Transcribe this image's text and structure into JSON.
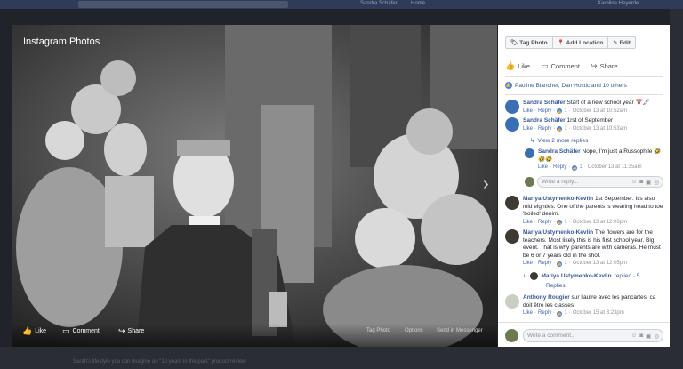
{
  "photo": {
    "title": "Instagram Photos",
    "actions": {
      "like": "Like",
      "comment": "Comment",
      "share": "Share"
    },
    "options": {
      "tag": "Tag Photo",
      "options": "Options",
      "messenger": "Send in Messenger"
    }
  },
  "panel": {
    "toolbar": {
      "tag_photo": "Tag Photo",
      "add_location": "Add Location",
      "edit": "Edit"
    },
    "actions": {
      "like": "Like",
      "comment": "Comment",
      "share": "Share"
    },
    "likes_text": "Pauline Blanchet, Dan Hostic and 10 others",
    "comments": [
      {
        "name": "Sandra Schäfer",
        "text": "Start of a new school year 📅🖊",
        "like": "Like",
        "reply": "Reply",
        "count": "1",
        "time": "October 13 at 10:52am"
      },
      {
        "name": "Sandra Schäfer",
        "text": "1rst of September",
        "like": "Like",
        "reply": "Reply",
        "count": "1",
        "time": "October 13 at 10:53am"
      },
      {
        "name": "Mariya Ustymenko-Kevlin",
        "text": "1st September. It's also mid eighties. One of the parents is wearing head to toe 'boiled' denim.",
        "like": "Like",
        "reply": "Reply",
        "count": "1",
        "time": "October 13 at 12:03pm"
      },
      {
        "name": "Mariya Ustymenko-Kevlin",
        "text": "The flowers are for the teachers. Most likely this is his first school year. Big event. That is why parents are with cameras. He must be 6 or 7 years old in the shot.",
        "like": "Like",
        "reply": "Reply",
        "count": "1",
        "time": "October 13 at 12:05pm"
      },
      {
        "name": "Anthony Rougier",
        "text": "sur l'autre avec les pancartes, ca doit être les classes",
        "like": "Like",
        "reply": "Reply",
        "count": "1",
        "time": "October 15 at 3:23pm"
      }
    ],
    "view_more": "View 2 more replies",
    "reply": {
      "name": "Sandra Schäfer",
      "text": "Nope, I'm just a Russophile 🤣🤣🤣",
      "like": "Like",
      "reply": "Reply",
      "count": "1",
      "time": "October 13 at 11:35am"
    },
    "write_reply": "Write a reply...",
    "replied": {
      "name": "Mariya Ustymenko-Kevlin",
      "text": "replied · 5",
      "more": "Replies"
    },
    "write_comment": "Write a comment..."
  },
  "background": {
    "top_right_1": "Sandra Schäfer",
    "top_right_2": "Home",
    "top_right_3": "Karoline Heyerde",
    "bottom_text": "Sarah's lifestyle you can imagine on \"10 years in the past\" product review"
  },
  "colors": {
    "accent": "#365899",
    "like": "#4080ff",
    "panel_bg": "#ffffff"
  }
}
